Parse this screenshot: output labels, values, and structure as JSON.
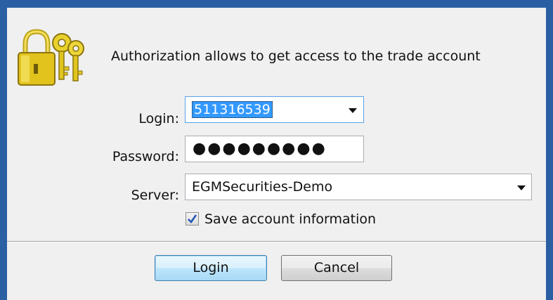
{
  "dialog": {
    "header_text": "Authorization allows to get access to the trade account"
  },
  "form": {
    "login_label": "Login:",
    "login_value": "511316539",
    "password_label": "Password:",
    "password_mask": "●●●●●●●●●",
    "server_label": "Server:",
    "server_value": "EGMSecurities-Demo",
    "save_info_label": "Save account information",
    "save_info_checked": true
  },
  "buttons": {
    "login_label": "Login",
    "cancel_label": "Cancel"
  },
  "colors": {
    "window_frame": "#2a5fa3",
    "dialog_bg": "#f0f0f0",
    "selection": "#3399ff",
    "lock_gold": "#e2c21c"
  },
  "icons": {
    "header": "lock-with-keys-icon",
    "dropdown": "chevron-down-icon",
    "check": "checkmark-icon"
  }
}
